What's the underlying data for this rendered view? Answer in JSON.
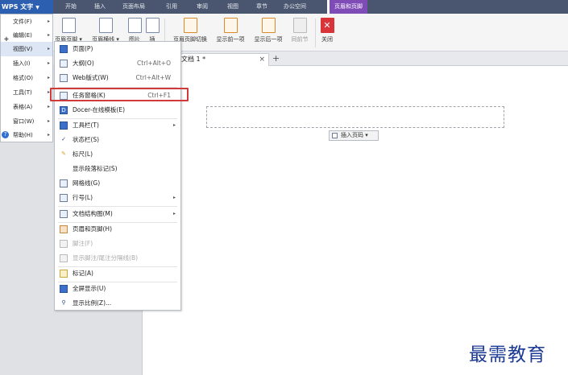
{
  "app": {
    "wps_button": "WPS 文字"
  },
  "ribbon_tabs": [
    "开始",
    "插入",
    "页面布局",
    "引用",
    "审阅",
    "视图",
    "章节",
    "办公空间"
  ],
  "active_tab": "页眉和页脚",
  "ribbon": {
    "btn1": "页眉页脚 ▾",
    "btn2": "页眉横线 ▾",
    "btn3": "图片",
    "btn4": "插",
    "btn5": "页眉页脚切换",
    "btn6": "显示前一项",
    "btn7": "显示后一项",
    "btn8": "同前节",
    "btn9": "关闭"
  },
  "doc_tab": {
    "title": "文档 1 *",
    "close": "×",
    "new": "+"
  },
  "main_menu": [
    {
      "label": "文件(F)"
    },
    {
      "label": "编辑(E)"
    },
    {
      "label": "视图(V)"
    },
    {
      "label": "插入(I)"
    },
    {
      "label": "格式(O)"
    },
    {
      "label": "工具(T)"
    },
    {
      "label": "表格(A)"
    },
    {
      "label": "窗口(W)"
    },
    {
      "label": "帮助(H)"
    }
  ],
  "view_menu": {
    "page": {
      "label": "页面(P)"
    },
    "outline": {
      "label": "大纲(O)",
      "shortcut": "Ctrl+Alt+O"
    },
    "web": {
      "label": "Web版式(W)",
      "shortcut": "Ctrl+Alt+W"
    },
    "taskpane": {
      "label": "任务窗格(K)",
      "shortcut": "Ctrl+F1"
    },
    "docer": {
      "label": "Docer-在线模板(E)"
    },
    "toolbar": {
      "label": "工具栏(T)"
    },
    "statusbar": {
      "label": "状态栏(S)"
    },
    "ruler": {
      "label": "标尺(L)"
    },
    "marks": {
      "label": "显示段落标记(S)"
    },
    "grid": {
      "label": "网格线(G)"
    },
    "linenum": {
      "label": "行号(L)"
    },
    "docmap": {
      "label": "文档结构图(M)"
    },
    "headerfooter": {
      "label": "页眉和页脚(H)"
    },
    "footnote": {
      "label": "脚注(F)"
    },
    "showfootnote": {
      "label": "显示脚注/尾注分隔线(B)"
    },
    "markup": {
      "label": "标记(A)"
    },
    "fullscreen": {
      "label": "全屏显示(U)"
    },
    "zoom": {
      "label": "显示比例(Z)..."
    }
  },
  "page": {
    "insert_pagenum": "插入页码 ▾"
  },
  "watermark": "最需教育"
}
